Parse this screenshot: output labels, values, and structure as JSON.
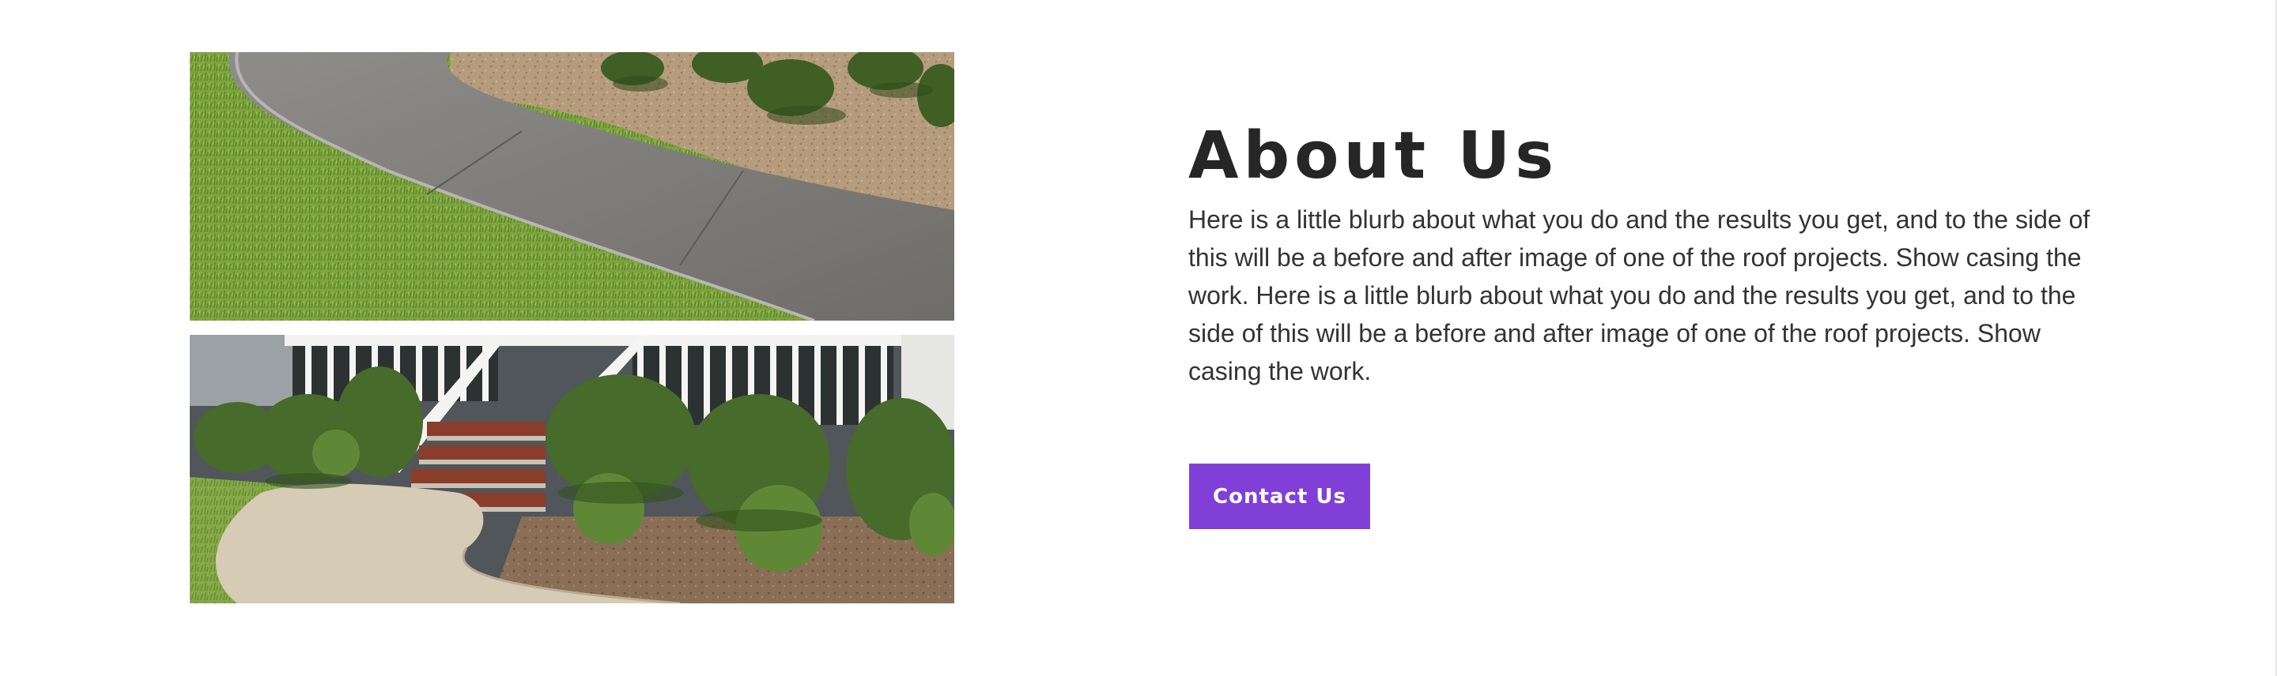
{
  "about": {
    "heading": "About Us",
    "body": "Here is a little blurb about what you do and the results you get, and to the side of this will be a before and after image of one of the roof projects. Show casing the work. Here is a little blurb about what you do and the results you get, and to the side of this will be a before and after image of one of the roof projects. Show casing the work.",
    "button_label": "Contact Us"
  },
  "colors": {
    "accent": "#8040d8",
    "heading": "#262626",
    "text": "#333333",
    "background": "#ffffff"
  },
  "images": [
    {
      "role": "before",
      "content": "lawn-and-sidewalk-photo"
    },
    {
      "role": "after",
      "content": "porch-and-shrubs-photo"
    }
  ]
}
